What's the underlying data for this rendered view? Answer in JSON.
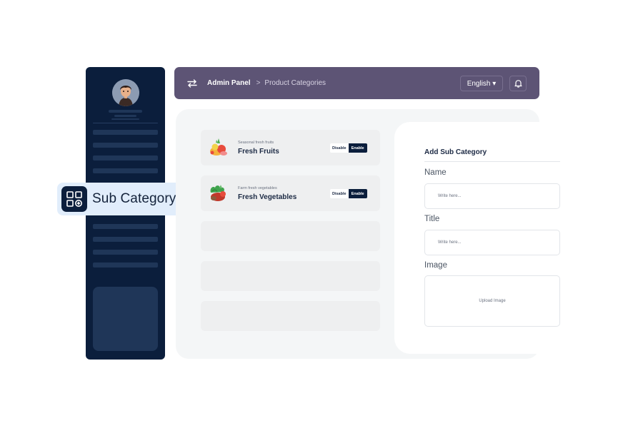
{
  "header": {
    "crumb_root": "Admin Panel",
    "crumb_separator": ">",
    "crumb_current": "Product Categories",
    "language": "English ▾",
    "swap_icon": "swap-arrows-icon",
    "bell_icon": "bell-icon"
  },
  "sidebar": {
    "avatar_icon": "user-avatar"
  },
  "chip": {
    "label": "Sub Category",
    "icon": "category-grid-add-icon"
  },
  "categories": [
    {
      "subtitle": "Seasonal fresh fruits",
      "title": "Fresh Fruits",
      "disable_label": "Disable",
      "enable_label": "Enable",
      "icon": "fruits-icon"
    },
    {
      "subtitle": "Farm fresh vegetables",
      "title": "Fresh Vegetables",
      "disable_label": "Disable",
      "enable_label": "Enable",
      "icon": "vegetables-icon"
    }
  ],
  "form": {
    "title": "Add Sub Category",
    "name_label": "Name",
    "name_placeholder": "Write here...",
    "title_label": "Title",
    "title_placeholder": "Write here...",
    "image_label": "Image",
    "upload_text": "Upload Image"
  },
  "colors": {
    "sidebar": "#0b1e3c",
    "header": "#5d5475",
    "accent": "#0b1e3c",
    "chip_bg": "#e1edfb"
  }
}
